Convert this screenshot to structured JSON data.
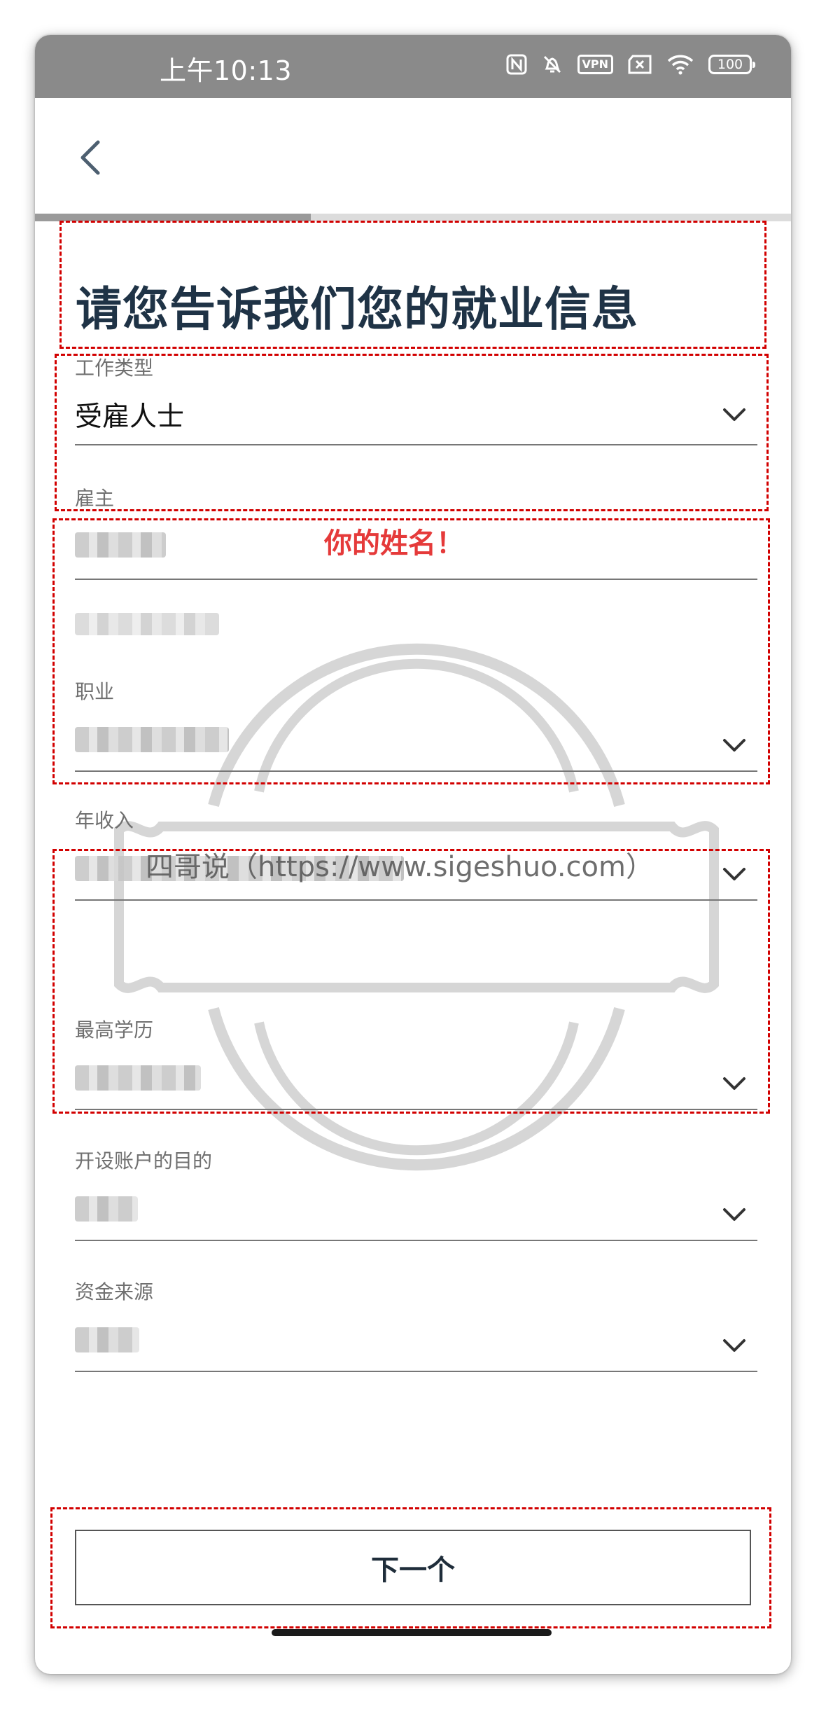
{
  "status_bar": {
    "time": "上午10:13",
    "vpn_label": "VPN",
    "battery_level": "100",
    "icons": [
      "nfc-icon",
      "mute-icon",
      "vpn-icon",
      "sim-icon",
      "wifi-icon",
      "battery-icon"
    ]
  },
  "nav": {
    "back_icon": "chevron-left-icon"
  },
  "progress": {
    "fraction": 0.365
  },
  "title": "请您告诉我们您的就业信息",
  "fields": {
    "work_type": {
      "label": "工作类型",
      "value": "受雇人士"
    },
    "employer": {
      "label": "雇主"
    },
    "occupation": {
      "label": "职业"
    },
    "annual_income": {
      "label": "年收入"
    },
    "education": {
      "label": "最高学历"
    },
    "account_purpose": {
      "label": "开设账户的目的"
    },
    "source_of_funds": {
      "label": "资金来源"
    }
  },
  "annotation": {
    "note": "你的姓名！",
    "watermark": "四哥说（https://www.sigeshuo.com）"
  },
  "next_button_label": "下一个",
  "colors": {
    "status_bar": "#8a8a8a",
    "title": "#1f3346",
    "annotation_red": "#d20000",
    "progress_fill": "#9a9a9a",
    "progress_track": "#dcdcdc"
  }
}
